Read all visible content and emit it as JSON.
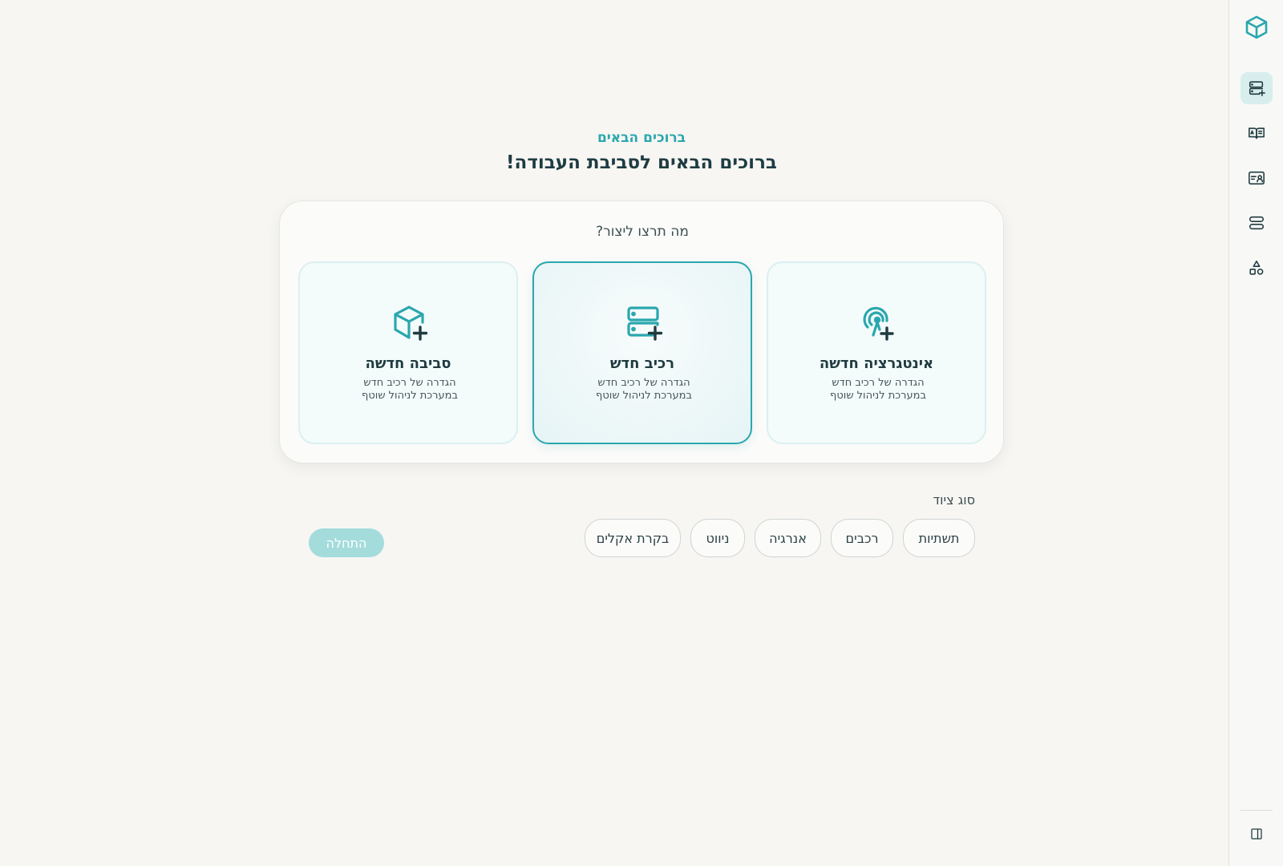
{
  "header": {
    "eyebrow": "ברוכים הבאים",
    "title": "ברוכים הבאים לסביבת העבודה!"
  },
  "panel": {
    "question": "מה תרצו ליצור?",
    "options": [
      {
        "title": "אינטגרציה חדשה",
        "desc_line1": "הגדרה של רכיב חדש",
        "desc_line2": "במערכת לניהול שוטף",
        "icon": "integration-plus-icon",
        "selected": false
      },
      {
        "title": "רכיב חדש",
        "desc_line1": "הגדרה של רכיב חדש",
        "desc_line2": "במערכת לניהול שוטף",
        "icon": "server-plus-icon",
        "selected": true
      },
      {
        "title": "סביבה חדשה",
        "desc_line1": "הגדרה של רכיב חדש",
        "desc_line2": "במערכת לניהול שוטף",
        "icon": "cube-plus-icon",
        "selected": false
      }
    ]
  },
  "equipment": {
    "label": "סוג ציוד",
    "chips": [
      "תשתיות",
      "רכבים",
      "אנרגיה",
      "ניווט",
      "בקרת אקלים"
    ]
  },
  "actions": {
    "start_label": "התחלה"
  },
  "sidebar": {
    "items": [
      "server-plus-icon",
      "book-icon",
      "contact-card-icon",
      "stack-icon",
      "shapes-icon"
    ],
    "active_index": 0
  },
  "colors": {
    "accent": "#2aa7ae",
    "accent_light": "#d8eeee",
    "start_disabled": "#a4dcdc",
    "text_dark": "#1f3b40"
  }
}
